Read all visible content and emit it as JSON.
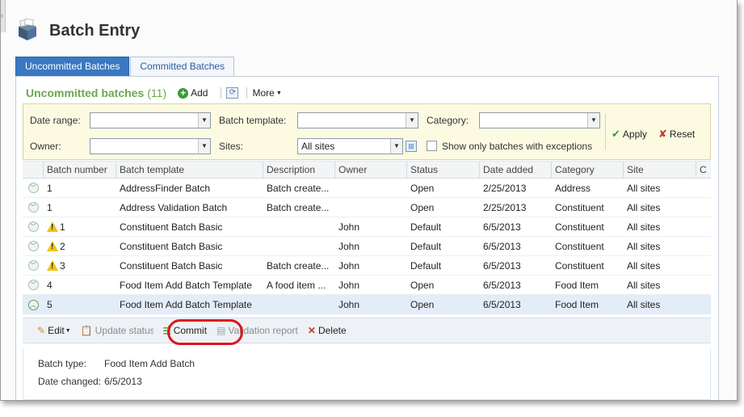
{
  "page": {
    "title": "Batch Entry",
    "icon": "batch-stack-icon"
  },
  "tabs": [
    {
      "label": "Uncommitted Batches",
      "active": true
    },
    {
      "label": "Committed Batches",
      "active": false
    }
  ],
  "section": {
    "title": "Uncommitted batches",
    "count": "(11)",
    "add_label": "Add",
    "more_label": "More"
  },
  "filters": {
    "date_range_label": "Date range:",
    "date_range_value": "",
    "batch_template_label": "Batch template:",
    "batch_template_value": "",
    "category_label": "Category:",
    "category_value": "",
    "owner_label": "Owner:",
    "owner_value": "",
    "sites_label": "Sites:",
    "sites_value": "All sites",
    "exceptions_label": "Show only batches with exceptions",
    "exceptions_checked": false,
    "apply_label": "Apply",
    "reset_label": "Reset"
  },
  "grid": {
    "columns": [
      "Batch number",
      "Batch template",
      "Description",
      "Owner",
      "Status",
      "Date added",
      "Category",
      "Site",
      "C"
    ],
    "rows": [
      {
        "warning": false,
        "number": "1",
        "template": "AddressFinder Batch",
        "description": "Batch create...",
        "owner": "",
        "status": "Open",
        "date": "2/25/2013",
        "category": "Address",
        "site": "All sites"
      },
      {
        "warning": false,
        "number": "1",
        "template": "Address Validation Batch",
        "description": "Batch create...",
        "owner": "",
        "status": "Open",
        "date": "2/25/2013",
        "category": "Constituent",
        "site": "All sites"
      },
      {
        "warning": true,
        "number": "1",
        "template": "Constituent Batch Basic",
        "description": "",
        "owner": "John",
        "status": "Default",
        "date": "6/5/2013",
        "category": "Constituent",
        "site": "All sites"
      },
      {
        "warning": true,
        "number": "2",
        "template": "Constituent Batch Basic",
        "description": "",
        "owner": "John",
        "status": "Default",
        "date": "6/5/2013",
        "category": "Constituent",
        "site": "All sites"
      },
      {
        "warning": true,
        "number": "3",
        "template": "Constituent Batch Basic",
        "description": "Batch create...",
        "owner": "John",
        "status": "Default",
        "date": "6/5/2013",
        "category": "Constituent",
        "site": "All sites"
      },
      {
        "warning": false,
        "number": "4",
        "template": "Food Item Add Batch Template",
        "description": "A food item ...",
        "owner": "John",
        "status": "Open",
        "date": "6/5/2013",
        "category": "Food Item",
        "site": "All sites"
      },
      {
        "warning": false,
        "selected": true,
        "number": "5",
        "template": "Food Item Add Batch Template",
        "description": "",
        "owner": "John",
        "status": "Open",
        "date": "6/5/2013",
        "category": "Food Item",
        "site": "All sites"
      }
    ]
  },
  "actions": {
    "edit_label": "Edit",
    "update_status_label": "Update status",
    "commit_label": "Commit",
    "validation_report_label": "Validation report",
    "delete_label": "Delete"
  },
  "detail": {
    "batch_type_label": "Batch type:",
    "batch_type_value": "Food Item Add Batch",
    "date_changed_label": "Date changed:",
    "date_changed_value": "6/5/2013"
  },
  "colors": {
    "accent": "#3a78c2",
    "section_green": "#6aa84f",
    "highlight_ring": "#e0141c",
    "filter_bg": "#fcfbe2"
  }
}
